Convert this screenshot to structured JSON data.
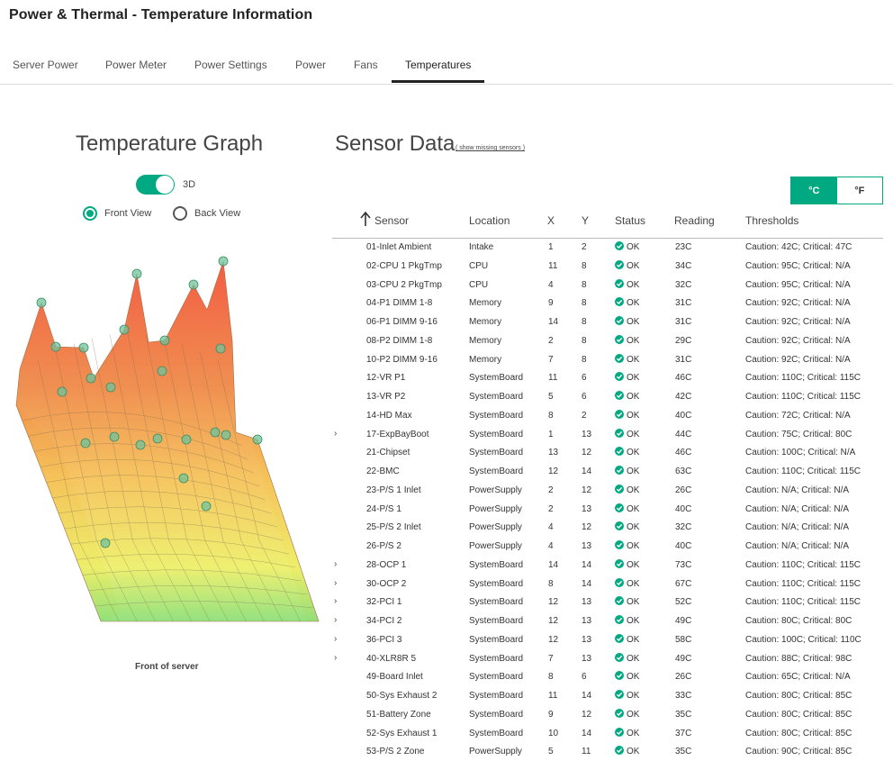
{
  "page": {
    "title": "Power & Thermal - Temperature Information"
  },
  "tabs": [
    {
      "label": "Server Power",
      "active": false
    },
    {
      "label": "Power Meter",
      "active": false
    },
    {
      "label": "Power Settings",
      "active": false
    },
    {
      "label": "Power",
      "active": false
    },
    {
      "label": "Fans",
      "active": false
    },
    {
      "label": "Temperatures",
      "active": true
    }
  ],
  "graph": {
    "title": "Temperature Graph",
    "toggle_label": "3D",
    "toggle_on": true,
    "views": [
      {
        "label": "Front View",
        "selected": true
      },
      {
        "label": "Back View",
        "selected": false
      }
    ],
    "caption": "Front of server"
  },
  "sensor_data": {
    "title": "Sensor Data",
    "missing_link": "( show missing sensors )",
    "units": [
      {
        "label": "°C",
        "active": true
      },
      {
        "label": "°F",
        "active": false
      }
    ],
    "columns": [
      "Sensor",
      "Location",
      "X",
      "Y",
      "Status",
      "Reading",
      "Thresholds"
    ],
    "colors": {
      "accent": "#01a982"
    },
    "rows": [
      {
        "sensor": "01-Inlet Ambient",
        "location": "Intake",
        "x": "1",
        "y": "2",
        "status": "OK",
        "reading": "23C",
        "thresholds": "Caution: 42C; Critical: 47C",
        "expandable": false
      },
      {
        "sensor": "02-CPU 1 PkgTmp",
        "location": "CPU",
        "x": "11",
        "y": "8",
        "status": "OK",
        "reading": "34C",
        "thresholds": "Caution: 95C; Critical: N/A",
        "expandable": false
      },
      {
        "sensor": "03-CPU 2 PkgTmp",
        "location": "CPU",
        "x": "4",
        "y": "8",
        "status": "OK",
        "reading": "32C",
        "thresholds": "Caution: 95C; Critical: N/A",
        "expandable": false
      },
      {
        "sensor": "04-P1 DIMM 1-8",
        "location": "Memory",
        "x": "9",
        "y": "8",
        "status": "OK",
        "reading": "31C",
        "thresholds": "Caution: 92C; Critical: N/A",
        "expandable": false
      },
      {
        "sensor": "06-P1 DIMM 9-16",
        "location": "Memory",
        "x": "14",
        "y": "8",
        "status": "OK",
        "reading": "31C",
        "thresholds": "Caution: 92C; Critical: N/A",
        "expandable": false
      },
      {
        "sensor": "08-P2 DIMM 1-8",
        "location": "Memory",
        "x": "2",
        "y": "8",
        "status": "OK",
        "reading": "29C",
        "thresholds": "Caution: 92C; Critical: N/A",
        "expandable": false
      },
      {
        "sensor": "10-P2 DIMM 9-16",
        "location": "Memory",
        "x": "7",
        "y": "8",
        "status": "OK",
        "reading": "31C",
        "thresholds": "Caution: 92C; Critical: N/A",
        "expandable": false
      },
      {
        "sensor": "12-VR P1",
        "location": "SystemBoard",
        "x": "11",
        "y": "6",
        "status": "OK",
        "reading": "46C",
        "thresholds": "Caution: 110C; Critical: 115C",
        "expandable": false
      },
      {
        "sensor": "13-VR P2",
        "location": "SystemBoard",
        "x": "5",
        "y": "6",
        "status": "OK",
        "reading": "42C",
        "thresholds": "Caution: 110C; Critical: 115C",
        "expandable": false
      },
      {
        "sensor": "14-HD Max",
        "location": "SystemBoard",
        "x": "8",
        "y": "2",
        "status": "OK",
        "reading": "40C",
        "thresholds": "Caution: 72C; Critical: N/A",
        "expandable": false
      },
      {
        "sensor": "17-ExpBayBoot",
        "location": "SystemBoard",
        "x": "1",
        "y": "13",
        "status": "OK",
        "reading": "44C",
        "thresholds": "Caution: 75C; Critical: 80C",
        "expandable": true
      },
      {
        "sensor": "21-Chipset",
        "location": "SystemBoard",
        "x": "13",
        "y": "12",
        "status": "OK",
        "reading": "46C",
        "thresholds": "Caution: 100C; Critical: N/A",
        "expandable": false
      },
      {
        "sensor": "22-BMC",
        "location": "SystemBoard",
        "x": "12",
        "y": "14",
        "status": "OK",
        "reading": "63C",
        "thresholds": "Caution: 110C; Critical: 115C",
        "expandable": false
      },
      {
        "sensor": "23-P/S 1 Inlet",
        "location": "PowerSupply",
        "x": "2",
        "y": "12",
        "status": "OK",
        "reading": "26C",
        "thresholds": "Caution: N/A; Critical: N/A",
        "expandable": false
      },
      {
        "sensor": "24-P/S 1",
        "location": "PowerSupply",
        "x": "2",
        "y": "13",
        "status": "OK",
        "reading": "40C",
        "thresholds": "Caution: N/A; Critical: N/A",
        "expandable": false
      },
      {
        "sensor": "25-P/S 2 Inlet",
        "location": "PowerSupply",
        "x": "4",
        "y": "12",
        "status": "OK",
        "reading": "32C",
        "thresholds": "Caution: N/A; Critical: N/A",
        "expandable": false
      },
      {
        "sensor": "26-P/S 2",
        "location": "PowerSupply",
        "x": "4",
        "y": "13",
        "status": "OK",
        "reading": "40C",
        "thresholds": "Caution: N/A; Critical: N/A",
        "expandable": false
      },
      {
        "sensor": "28-OCP 1",
        "location": "SystemBoard",
        "x": "14",
        "y": "14",
        "status": "OK",
        "reading": "73C",
        "thresholds": "Caution: 110C; Critical: 115C",
        "expandable": true
      },
      {
        "sensor": "30-OCP 2",
        "location": "SystemBoard",
        "x": "8",
        "y": "14",
        "status": "OK",
        "reading": "67C",
        "thresholds": "Caution: 110C; Critical: 115C",
        "expandable": true
      },
      {
        "sensor": "32-PCI 1",
        "location": "SystemBoard",
        "x": "12",
        "y": "13",
        "status": "OK",
        "reading": "52C",
        "thresholds": "Caution: 110C; Critical: 115C",
        "expandable": true
      },
      {
        "sensor": "34-PCI 2",
        "location": "SystemBoard",
        "x": "12",
        "y": "13",
        "status": "OK",
        "reading": "49C",
        "thresholds": "Caution: 80C; Critical: 80C",
        "expandable": true
      },
      {
        "sensor": "36-PCI 3",
        "location": "SystemBoard",
        "x": "12",
        "y": "13",
        "status": "OK",
        "reading": "58C",
        "thresholds": "Caution: 100C; Critical: 110C",
        "expandable": true
      },
      {
        "sensor": "40-XLR8R 5",
        "location": "SystemBoard",
        "x": "7",
        "y": "13",
        "status": "OK",
        "reading": "49C",
        "thresholds": "Caution: 88C; Critical: 98C",
        "expandable": true
      },
      {
        "sensor": "49-Board Inlet",
        "location": "SystemBoard",
        "x": "8",
        "y": "6",
        "status": "OK",
        "reading": "26C",
        "thresholds": "Caution: 65C; Critical: N/A",
        "expandable": false
      },
      {
        "sensor": "50-Sys Exhaust 2",
        "location": "SystemBoard",
        "x": "11",
        "y": "14",
        "status": "OK",
        "reading": "33C",
        "thresholds": "Caution: 80C; Critical: 85C",
        "expandable": false
      },
      {
        "sensor": "51-Battery Zone",
        "location": "SystemBoard",
        "x": "9",
        "y": "12",
        "status": "OK",
        "reading": "35C",
        "thresholds": "Caution: 80C; Critical: 85C",
        "expandable": false
      },
      {
        "sensor": "52-Sys Exhaust 1",
        "location": "SystemBoard",
        "x": "10",
        "y": "14",
        "status": "OK",
        "reading": "37C",
        "thresholds": "Caution: 80C; Critical: 85C",
        "expandable": false
      },
      {
        "sensor": "53-P/S 2 Zone",
        "location": "PowerSupply",
        "x": "5",
        "y": "11",
        "status": "OK",
        "reading": "35C",
        "thresholds": "Caution: 90C; Critical: 85C",
        "expandable": false
      }
    ]
  }
}
